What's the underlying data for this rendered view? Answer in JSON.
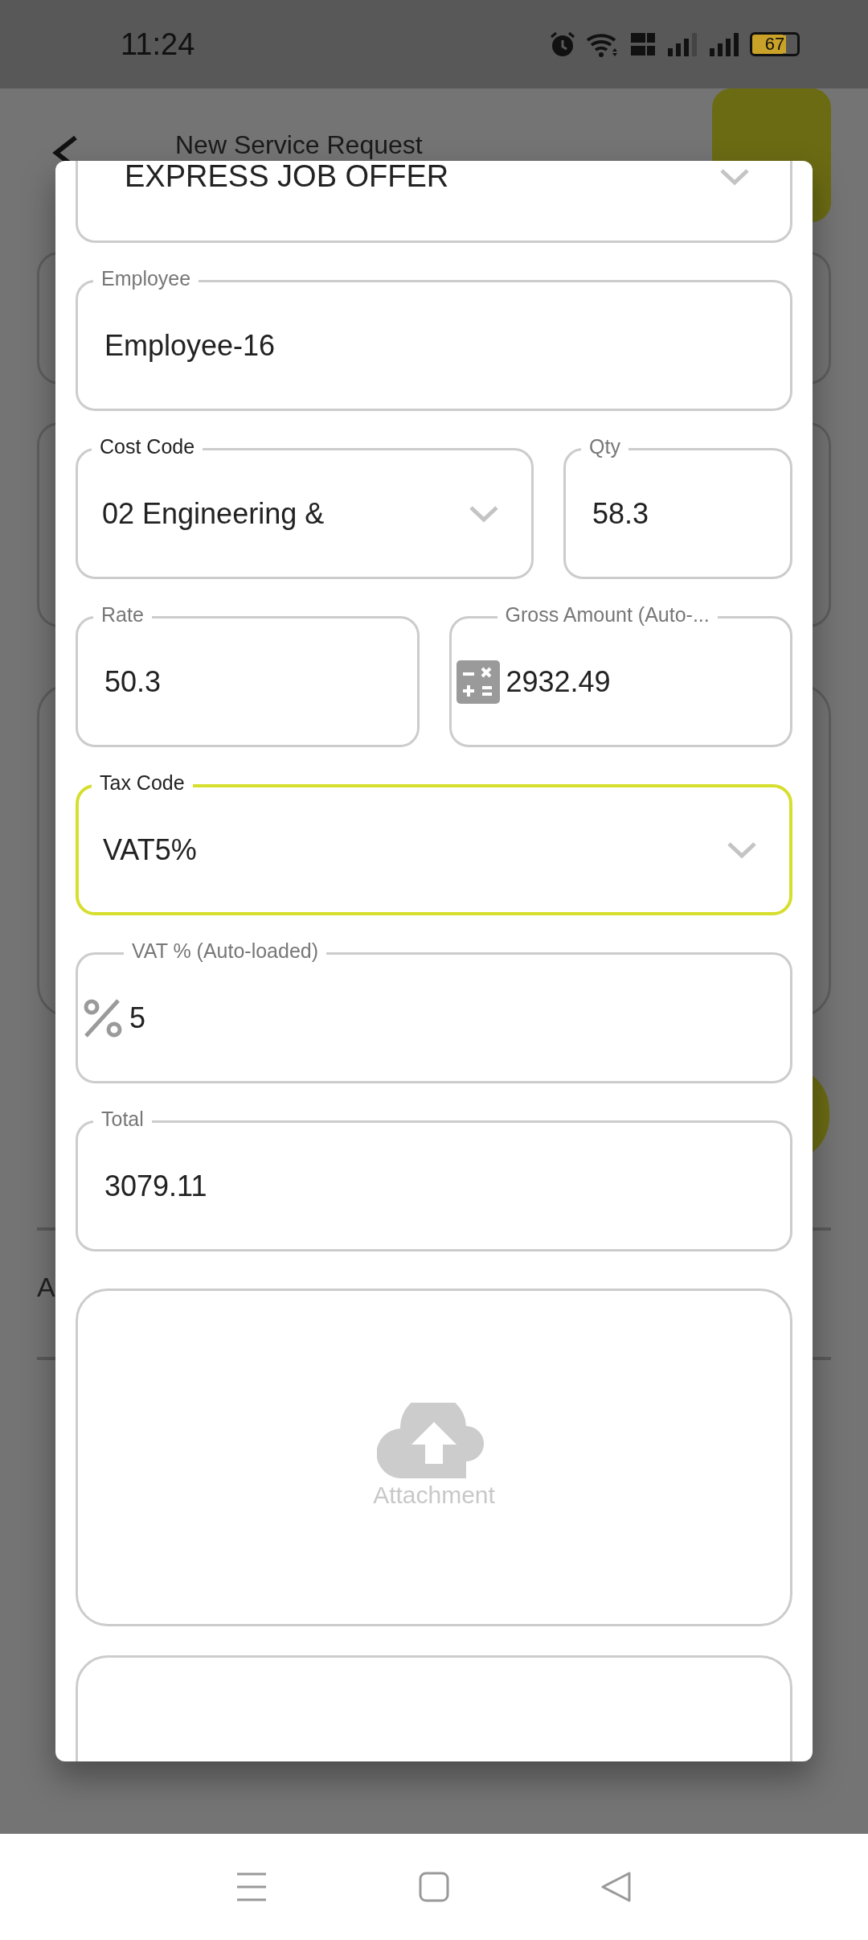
{
  "status_bar": {
    "time": "11:24",
    "battery": "67"
  },
  "background": {
    "title": "New Service Request",
    "peek_text": "A"
  },
  "dialog": {
    "top_field": {
      "value": "EXPRESS JOB OFFER"
    },
    "rows": [
      {
        "fields": [
          {
            "kind": "text",
            "label": "Employee",
            "value": "Employee-16",
            "focused": false
          }
        ]
      },
      {
        "fields": [
          {
            "kind": "dropdown",
            "label": "Cost Code",
            "value": "02 Engineering &",
            "focused": false
          },
          {
            "kind": "text",
            "label": "Qty",
            "value": "58.3",
            "focused": false
          }
        ]
      },
      {
        "fields": [
          {
            "kind": "text",
            "label": "Rate",
            "value": "50.3",
            "focused": false
          },
          {
            "kind": "calculator",
            "label": "Gross Amount (Auto-...",
            "value": "2932.49",
            "focused": false
          }
        ]
      },
      {
        "fields": [
          {
            "kind": "dropdown",
            "label": "Tax Code",
            "value": "VAT5%",
            "focused": true
          }
        ]
      },
      {
        "fields": [
          {
            "kind": "percent",
            "label": "VAT % (Auto-loaded)",
            "value": "5",
            "focused": false
          }
        ]
      },
      {
        "fields": [
          {
            "kind": "text",
            "label": "Total",
            "value": "3079.11",
            "focused": false
          }
        ]
      }
    ],
    "attachment": {
      "label": "Attachment"
    }
  }
}
